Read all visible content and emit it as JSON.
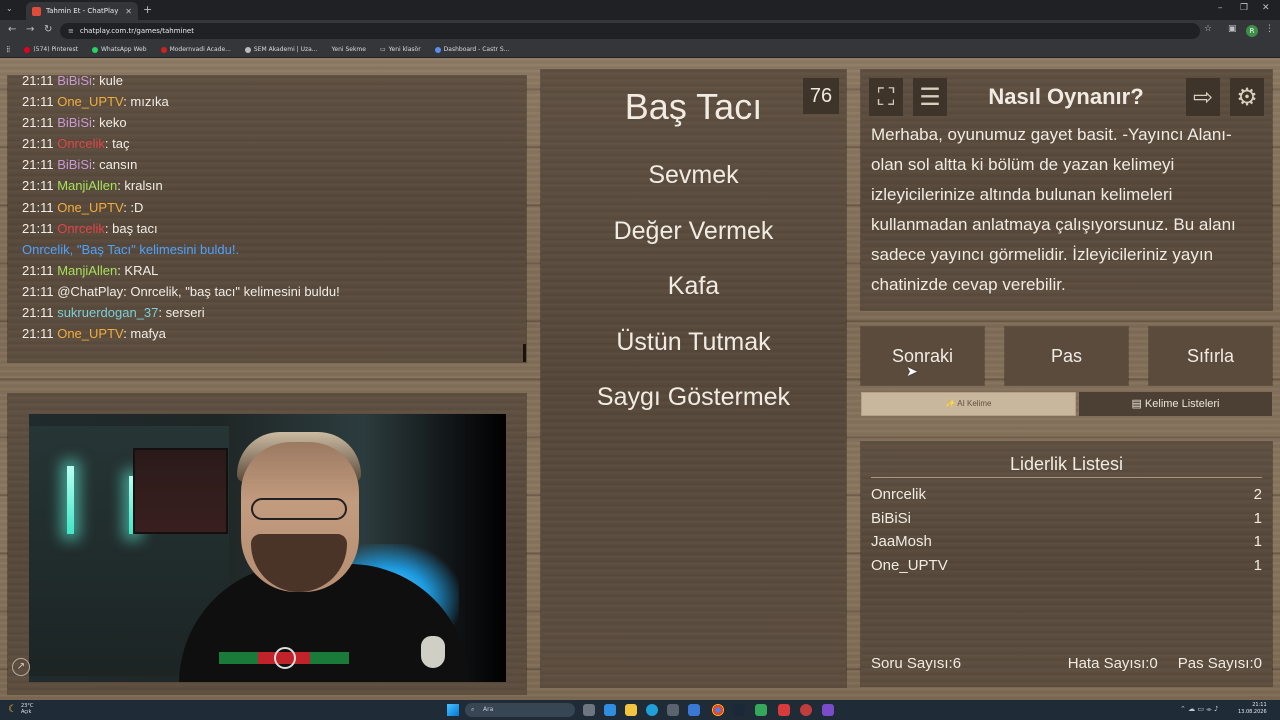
{
  "browser": {
    "tab_title": "Tahmin Et - ChatPlay",
    "url": "chatplay.com.tr/games/tahminet",
    "bookmarks": [
      "(574) Pinterest",
      "WhatsApp Web",
      "Modernvadi Acade...",
      "SEM Akademi | Uza...",
      "Yeni Sekme",
      "Yeni klasör",
      "Dashboard - Castr S..."
    ]
  },
  "chat": {
    "lines": [
      {
        "time": "21:11",
        "user": "BiBiSi",
        "user_color": "#c79ad6",
        "msg": ": kule"
      },
      {
        "time": "21:11",
        "user": "One_UPTV",
        "user_color": "#f2ad3d",
        "msg": ": mızıka"
      },
      {
        "time": "21:11",
        "user": "BiBiSi",
        "user_color": "#c79ad6",
        "msg": ": keko"
      },
      {
        "time": "21:11",
        "user": "Onrcelik",
        "user_color": "#e0454a",
        "msg": ": taç"
      },
      {
        "time": "21:11",
        "user": "BiBiSi",
        "user_color": "#c79ad6",
        "msg": ": cansın"
      },
      {
        "time": "21:11",
        "user": "ManjiAllen",
        "user_color": "#a7e05a",
        "msg": ": kralsın"
      },
      {
        "time": "21:11",
        "user": "One_UPTV",
        "user_color": "#f2ad3d",
        "msg": ": :D"
      },
      {
        "time": "21:11",
        "user": "Onrcelik",
        "user_color": "#e0454a",
        "msg": ": baş tacı"
      },
      {
        "time": "",
        "user": "",
        "user_color": "#4ea1ff",
        "msg": "Onrcelik, \"Baş Tacı\" kelimesini buldu!.",
        "system": true
      },
      {
        "time": "21:11",
        "user": "ManjiAllen",
        "user_color": "#a7e05a",
        "msg": ": KRAL"
      },
      {
        "time": "21:11",
        "user": "@ChatPlay",
        "user_color": "#f2ede6",
        "msg": ": Onrcelik, \"baş tacı\" kelimesini buldu!"
      },
      {
        "time": "21:11",
        "user": "sukruerdogan_37",
        "user_color": "#7ad0d8",
        "msg": ": serseri"
      },
      {
        "time": "21:11",
        "user": "One_UPTV",
        "user_color": "#f2ad3d",
        "msg": ": mafya"
      }
    ]
  },
  "game": {
    "timer": "76",
    "main_word": "Baş Tacı",
    "taboo_words": [
      "Sevmek",
      "Değer Vermek",
      "Kafa",
      "Üstün Tutmak",
      "Saygı Göstermek"
    ]
  },
  "howto": {
    "title": "Nasıl Oynanır?",
    "text": "Merhaba, oyunumuz gayet basit. -Yayıncı Alanı- olan sol altta ki bölüm de yazan kelimeyi izleyicilerinize altında bulunan kelimeleri kullanmadan anlatmaya çalışıyorsunuz. Bu alanı sadece yayıncı görmelidir. İzleyicileriniz yayın chatinizde cevap verebilir."
  },
  "controls": {
    "next": "Sonraki",
    "pass": "Pas",
    "reset": "Sıfırla",
    "ai_word": "✨ AI Kelime",
    "word_lists": "Kelime Listeleri"
  },
  "leaderboard": {
    "title": "Liderlik Listesi",
    "rows": [
      {
        "name": "Onrcelik",
        "score": "2"
      },
      {
        "name": "BiBiSi",
        "score": "1"
      },
      {
        "name": "JaaMosh",
        "score": "1"
      },
      {
        "name": "One_UPTV",
        "score": "1"
      }
    ],
    "question_count": "Soru Sayısı:6",
    "error_count": "Hata Sayısı:0",
    "pass_count": "Pas Sayısı:0"
  },
  "taskbar": {
    "weather_temp": "23°C",
    "weather_desc": "Açık",
    "search_placeholder": "Ara",
    "time": "21:11",
    "date": "13.08.2026"
  },
  "icons": [
    "fullscreen-icon",
    "notes-icon",
    "exit-icon",
    "gear-icon",
    "list-icon",
    "search-icon"
  ]
}
